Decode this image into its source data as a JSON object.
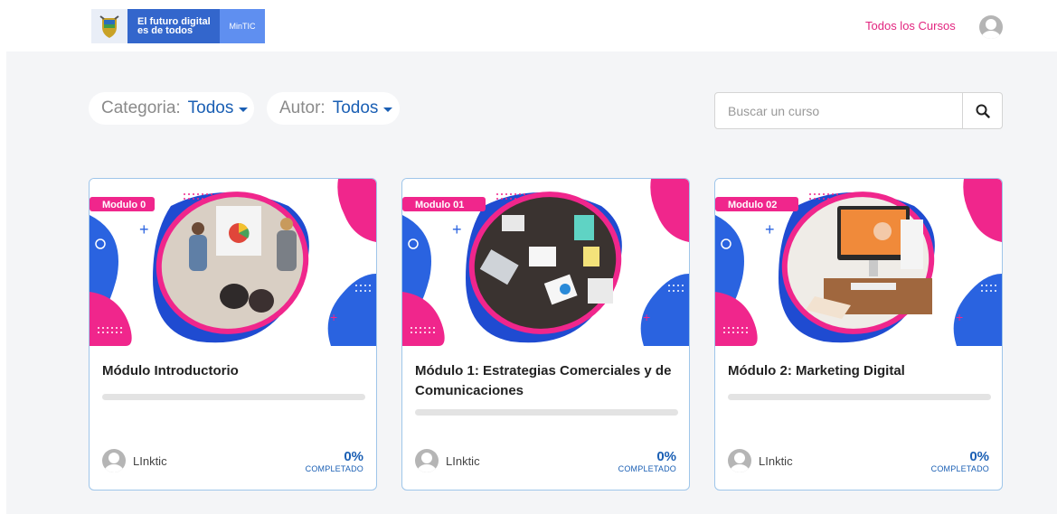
{
  "header": {
    "logo": {
      "text": "El futuro digital\nes de todos",
      "badge": "MinTIC"
    },
    "nav_link": "Todos los Cursos"
  },
  "filters": {
    "category": {
      "label": "Categoria:",
      "value": "Todos"
    },
    "author": {
      "label": "Autor:",
      "value": "Todos"
    }
  },
  "search": {
    "placeholder": "Buscar un curso"
  },
  "colors": {
    "accent": "#1a5fb4",
    "brand_pink": "#e2247f",
    "brand_blue": "#3366cc"
  },
  "courses": [
    {
      "badge": "Modulo 0",
      "title": "Módulo Introductorio",
      "progress": 0,
      "percent": "0%",
      "status": "COMPLETADO",
      "author": "LInktic"
    },
    {
      "badge": "Modulo 01",
      "title": "Módulo 1: Estrategias Comerciales y de Comunicaciones",
      "progress": 0,
      "percent": "0%",
      "status": "COMPLETADO",
      "author": "LInktic"
    },
    {
      "badge": "Modulo 02",
      "title": "Módulo 2: Marketing Digital",
      "progress": 0,
      "percent": "0%",
      "status": "COMPLETADO",
      "author": "LInktic"
    }
  ]
}
